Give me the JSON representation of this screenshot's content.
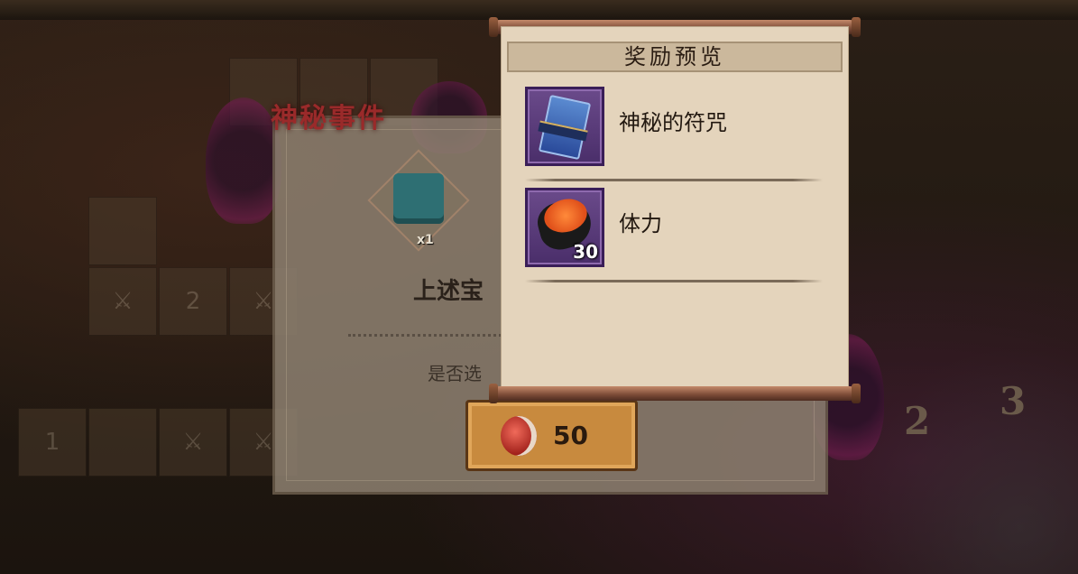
{
  "colors": {
    "title_red": "#9a2a2a",
    "scroll_paper": "#e4d4bc",
    "item_frame_purple": "#4a2e6a",
    "button_orange": "#c88a3e"
  },
  "board": {
    "tile_numbers": [
      "2",
      "1"
    ],
    "corner_numbers": [
      "3",
      "2"
    ]
  },
  "event_dialog": {
    "title": "神秘事件",
    "gift_count": "x1",
    "message_partial": "上述宝",
    "question_partial": "是否选",
    "cost_icon": "magatama-icon",
    "cost_value": "50"
  },
  "reward_preview": {
    "title": "奖励预览",
    "items": [
      {
        "name": "神秘的符咒",
        "icon": "talisman-icon",
        "count": ""
      },
      {
        "name": "体力",
        "icon": "sushi-icon",
        "count": "30"
      }
    ]
  }
}
